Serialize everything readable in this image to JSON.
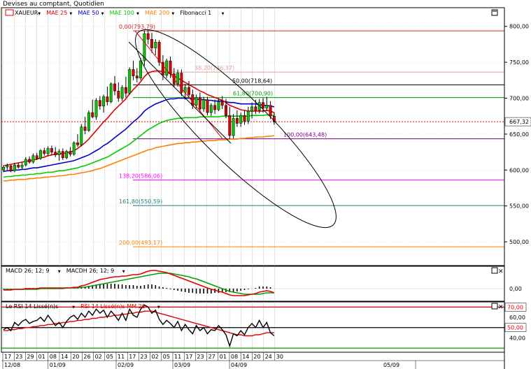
{
  "title": "Devises au comptant, Quotidien",
  "legend_main": [
    {
      "label": "XAUEUR",
      "color": "#000000"
    },
    {
      "label": "MAE 25",
      "color": "#e00000"
    },
    {
      "label": "MAE 50",
      "color": "#0000cc"
    },
    {
      "label": "MAE 100",
      "color": "#00cc00"
    },
    {
      "label": "MAE 200",
      "color": "#ff8000"
    },
    {
      "label": "Fibonacci 1",
      "color": "#000000"
    }
  ],
  "legend_macd": [
    {
      "label": "MACD 26; 12; 9",
      "color": "#000000"
    },
    {
      "label": "MACDH 26; 12; 9",
      "color": "#000000"
    }
  ],
  "legend_rsi": [
    {
      "label": "Le RSI 14 Lissé(n)s",
      "color": "#000000"
    },
    {
      "label": "RSI 14 Lissé(n)s MM 20",
      "color": "#e00000"
    }
  ],
  "last_price": "667,32",
  "colors": {
    "up": "#00cc00",
    "down": "#e00000",
    "ma25": "#e00000",
    "ma50": "#0000cc",
    "ma100": "#00cc00",
    "ma200": "#ff8000",
    "grid": "#c8c8c8"
  },
  "chart_data": {
    "type": "candlestick",
    "y_ticks": [
      "800,00",
      "750,00",
      "700,00",
      "650,00",
      "600,00",
      "550,00",
      "500,00"
    ],
    "ylim": [
      467,
      826
    ],
    "fibonacci": [
      {
        "label": "0,00(793,79)",
        "value": 793.79,
        "color": "#e02020"
      },
      {
        "label": "38,20(736,37)",
        "value": 736.37,
        "color": "#e0a0a0"
      },
      {
        "label": "50,00(718,64)",
        "value": 718.64,
        "color": "#000000"
      },
      {
        "label": "61,80(700,90)",
        "value": 700.9,
        "color": "#00a000"
      },
      {
        "label": "100,00(643,48)",
        "value": 643.48,
        "color": "#800080"
      },
      {
        "label": "138,20(586,06)",
        "value": 586.06,
        "color": "#ff00ff"
      },
      {
        "label": "161,80(550,59)",
        "value": 550.59,
        "color": "#208080"
      },
      {
        "label": "200,00(493,17)",
        "value": 493.17,
        "color": "#ff8000"
      }
    ],
    "x_ticks": [
      "17",
      "23",
      "29",
      "01",
      "08",
      "14",
      "20",
      "26",
      "02",
      "05",
      "11",
      "17",
      "23",
      "02",
      "05",
      "11",
      "17",
      "23",
      "27",
      "01",
      "08",
      "14",
      "20",
      "24",
      "30"
    ],
    "month_labels": [
      {
        "label": "12/08",
        "tick": 0
      },
      {
        "label": "01/09",
        "tick": 4
      },
      {
        "label": "02/09",
        "tick": 10
      },
      {
        "label": "03/09",
        "tick": 15
      },
      {
        "label": "04/09",
        "tick": 20
      }
    ],
    "future_label": "05/09",
    "candles": [
      [
        600,
        606,
        597,
        604
      ],
      [
        604,
        609,
        600,
        606
      ],
      [
        606,
        608,
        597,
        599
      ],
      [
        599,
        610,
        597,
        607
      ],
      [
        607,
        610,
        602,
        604
      ],
      [
        604,
        611,
        600,
        607
      ],
      [
        607,
        618,
        605,
        615
      ],
      [
        615,
        619,
        609,
        611
      ],
      [
        611,
        623,
        609,
        620
      ],
      [
        620,
        624,
        614,
        616
      ],
      [
        616,
        629,
        614,
        627
      ],
      [
        627,
        631,
        620,
        623
      ],
      [
        623,
        633,
        619,
        630
      ],
      [
        630,
        634,
        621,
        625
      ],
      [
        625,
        632,
        618,
        621
      ],
      [
        621,
        629,
        613,
        626
      ],
      [
        626,
        630,
        614,
        617
      ],
      [
        617,
        628,
        615,
        626
      ],
      [
        626,
        632,
        619,
        622
      ],
      [
        622,
        640,
        620,
        638
      ],
      [
        638,
        650,
        632,
        635
      ],
      [
        635,
        664,
        633,
        660
      ],
      [
        660,
        674,
        650,
        655
      ],
      [
        655,
        683,
        653,
        680
      ],
      [
        680,
        698,
        672,
        674
      ],
      [
        674,
        700,
        670,
        697
      ],
      [
        697,
        703,
        684,
        689
      ],
      [
        689,
        705,
        680,
        702
      ],
      [
        702,
        716,
        690,
        695
      ],
      [
        695,
        722,
        693,
        720
      ],
      [
        720,
        731,
        704,
        710
      ],
      [
        710,
        722,
        695,
        700
      ],
      [
        700,
        718,
        696,
        715
      ],
      [
        715,
        730,
        701,
        707
      ],
      [
        707,
        743,
        705,
        740
      ],
      [
        740,
        752,
        725,
        731
      ],
      [
        731,
        742,
        722,
        728
      ],
      [
        728,
        756,
        725,
        752
      ],
      [
        752,
        794,
        745,
        790
      ],
      [
        790,
        796,
        775,
        782
      ],
      [
        782,
        791,
        763,
        770
      ],
      [
        770,
        782,
        760,
        778
      ],
      [
        778,
        781,
        745,
        750
      ],
      [
        750,
        760,
        725,
        732
      ],
      [
        732,
        755,
        728,
        752
      ],
      [
        752,
        758,
        728,
        734
      ],
      [
        734,
        742,
        715,
        720
      ],
      [
        720,
        740,
        716,
        735
      ],
      [
        735,
        740,
        703,
        708
      ],
      [
        708,
        720,
        698,
        715
      ],
      [
        715,
        724,
        700,
        705
      ],
      [
        705,
        712,
        685,
        690
      ],
      [
        690,
        705,
        686,
        701
      ],
      [
        701,
        708,
        680,
        685
      ],
      [
        685,
        702,
        681,
        698
      ],
      [
        698,
        702,
        676,
        680
      ],
      [
        680,
        693,
        675,
        690
      ],
      [
        690,
        698,
        678,
        684
      ],
      [
        684,
        700,
        682,
        695
      ],
      [
        695,
        703,
        685,
        690
      ],
      [
        690,
        699,
        672,
        676
      ],
      [
        676,
        688,
        643,
        648
      ],
      [
        648,
        678,
        644,
        672
      ],
      [
        672,
        683,
        660,
        665
      ],
      [
        665,
        680,
        660,
        676
      ],
      [
        676,
        683,
        663,
        668
      ],
      [
        668,
        688,
        664,
        682
      ],
      [
        682,
        694,
        672,
        688
      ],
      [
        688,
        698,
        678,
        683
      ],
      [
        683,
        699,
        679,
        694
      ],
      [
        694,
        700,
        680,
        686
      ],
      [
        686,
        702,
        682,
        690
      ],
      [
        690,
        696,
        671,
        675
      ],
      [
        675,
        680,
        663,
        667
      ]
    ],
    "ma25": [
      606,
      607,
      608,
      609,
      610,
      611,
      612,
      613,
      614,
      615,
      617,
      618,
      620,
      621,
      622,
      623,
      623,
      624,
      625,
      627,
      630,
      634,
      638,
      643,
      649,
      655,
      661,
      667,
      672,
      678,
      684,
      689,
      694,
      699,
      706,
      712,
      717,
      723,
      730,
      735,
      737,
      738,
      738,
      737,
      736,
      734,
      731,
      728,
      725,
      722,
      719,
      716,
      713,
      710,
      708,
      705,
      703,
      701,
      699,
      697,
      694,
      690,
      688,
      686,
      684,
      683,
      682,
      682,
      682,
      682,
      682,
      683,
      682,
      680
    ],
    "ma50": [
      598,
      599,
      599,
      600,
      600,
      601,
      601,
      602,
      603,
      603,
      604,
      605,
      606,
      607,
      608,
      609,
      610,
      611,
      612,
      613,
      615,
      617,
      619,
      621,
      624,
      627,
      630,
      634,
      637,
      641,
      645,
      649,
      653,
      657,
      662,
      667,
      671,
      676,
      682,
      686,
      689,
      692,
      694,
      696,
      698,
      699,
      699,
      700,
      700,
      700,
      700,
      699,
      699,
      698,
      698,
      697,
      697,
      696,
      696,
      696,
      695,
      694,
      694,
      693,
      692,
      692,
      692,
      692,
      692,
      691,
      690,
      690,
      689,
      688
    ],
    "ma100": [
      590,
      591,
      591,
      592,
      592,
      593,
      593,
      594,
      594,
      595,
      595,
      596,
      597,
      597,
      598,
      599,
      599,
      600,
      601,
      602,
      603,
      605,
      606,
      608,
      610,
      612,
      614,
      616,
      618,
      621,
      624,
      627,
      630,
      633,
      636,
      640,
      644,
      648,
      652,
      656,
      659,
      662,
      665,
      667,
      669,
      670,
      671,
      672,
      672,
      673,
      673,
      673,
      673,
      674,
      674,
      674,
      674,
      674,
      674,
      675,
      675,
      675,
      675,
      675,
      675,
      675,
      675,
      676,
      676,
      676,
      676,
      677,
      676,
      676
    ],
    "ma200": [
      585,
      585,
      586,
      586,
      587,
      587,
      587,
      588,
      588,
      589,
      589,
      590,
      590,
      591,
      591,
      592,
      592,
      593,
      594,
      594,
      595,
      596,
      597,
      598,
      599,
      601,
      602,
      604,
      606,
      608,
      610,
      612,
      614,
      616,
      618,
      620,
      622,
      624,
      626,
      628,
      629,
      631,
      632,
      633,
      634,
      635,
      636,
      637,
      637,
      638,
      638,
      639,
      639,
      640,
      640,
      641,
      641,
      641,
      642,
      642,
      642,
      643,
      643,
      643,
      644,
      644,
      645,
      645,
      646,
      646,
      646,
      647,
      647,
      648
    ],
    "macd": {
      "ticks": [
        "0,00"
      ],
      "ylim": [
        -18,
        32
      ],
      "macd": [
        -2,
        -2,
        -2,
        -1,
        -1,
        -1,
        0,
        0,
        0,
        0,
        1,
        1,
        1,
        1,
        1,
        1,
        1,
        1,
        1,
        2,
        2,
        4,
        5,
        7,
        9,
        11,
        13,
        14,
        15,
        16,
        17,
        17,
        18,
        18,
        19,
        20,
        20,
        21,
        23,
        25,
        26,
        26,
        25,
        24,
        23,
        21,
        19,
        17,
        15,
        13,
        11,
        9,
        7,
        5,
        3,
        1,
        -1,
        -2,
        -4,
        -5,
        -7,
        -9,
        -10,
        -10,
        -10,
        -10,
        -9,
        -8,
        -7,
        -5,
        -4,
        -3,
        -4,
        -6
      ],
      "signal": [
        -1,
        -1,
        -1,
        -1,
        -1,
        -1,
        -1,
        -1,
        -1,
        -1,
        0,
        0,
        0,
        0,
        0,
        0,
        0,
        1,
        1,
        1,
        1,
        2,
        2,
        3,
        4,
        5,
        6,
        7,
        8,
        9,
        10,
        11,
        12,
        13,
        14,
        15,
        16,
        17,
        18,
        19,
        20,
        21,
        22,
        22,
        22,
        22,
        21,
        20,
        19,
        18,
        17,
        15,
        14,
        12,
        10,
        8,
        6,
        4,
        2,
        0,
        -2,
        -4,
        -5,
        -6,
        -7,
        -8,
        -8,
        -8,
        -8,
        -8,
        -7,
        -6,
        -6,
        -6
      ],
      "hist": [
        -1,
        -1,
        -1,
        0,
        0,
        0,
        1,
        1,
        1,
        1,
        1,
        1,
        1,
        1,
        1,
        1,
        1,
        0,
        0,
        1,
        1,
        2,
        3,
        4,
        5,
        6,
        7,
        7,
        7,
        7,
        7,
        6,
        6,
        5,
        5,
        5,
        4,
        4,
        5,
        6,
        6,
        5,
        3,
        2,
        1,
        -1,
        -2,
        -3,
        -4,
        -5,
        -6,
        -6,
        -7,
        -7,
        -7,
        -7,
        -7,
        -6,
        -6,
        -5,
        -5,
        -5,
        -5,
        -4,
        -3,
        -2,
        -1,
        0,
        1,
        3,
        3,
        3,
        2,
        0
      ]
    },
    "rsi": {
      "ticks": [
        "70,00",
        "60,00",
        "50,00",
        "40,00"
      ],
      "ylim": [
        26,
        75
      ],
      "overbought": 70,
      "mid": 50,
      "oversold": 30,
      "rsi": [
        48,
        50,
        47,
        55,
        52,
        56,
        58,
        54,
        56,
        57,
        60,
        56,
        62,
        57,
        52,
        55,
        50,
        56,
        60,
        62,
        58,
        64,
        60,
        66,
        62,
        68,
        64,
        67,
        60,
        66,
        62,
        57,
        64,
        57,
        68,
        62,
        60,
        68,
        72,
        70,
        64,
        67,
        58,
        53,
        57,
        54,
        50,
        56,
        47,
        53,
        48,
        44,
        52,
        47,
        50,
        44,
        48,
        47,
        52,
        48,
        43,
        32,
        44,
        42,
        47,
        43,
        50,
        54,
        50,
        57,
        50,
        55,
        45,
        42
      ],
      "rsi_ma": [
        47,
        47,
        48,
        48,
        49,
        49,
        50,
        50,
        51,
        51,
        52,
        52,
        53,
        53,
        54,
        54,
        55,
        55,
        56,
        56,
        57,
        57,
        58,
        58,
        59,
        59,
        60,
        60,
        61,
        61,
        62,
        62,
        63,
        63,
        64,
        64,
        65,
        65,
        66,
        66,
        66,
        65,
        64,
        63,
        62,
        61,
        60,
        59,
        58,
        57,
        56,
        55,
        54,
        53,
        52,
        51,
        50,
        49,
        48,
        47,
        46,
        45,
        44,
        43,
        43,
        42,
        42,
        42,
        43,
        43,
        44,
        45,
        45,
        45
      ]
    }
  }
}
